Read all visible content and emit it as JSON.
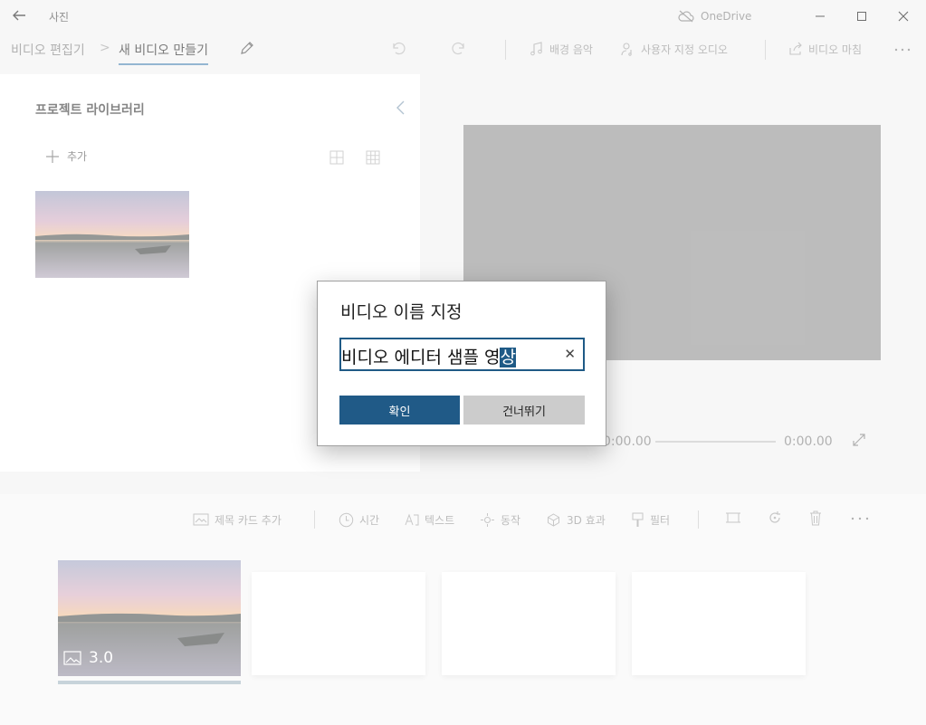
{
  "titlebar": {
    "app_name": "사진",
    "onedrive_label": "OneDrive"
  },
  "commandbar": {
    "breadcrumb_parent": "비디오 편집기",
    "breadcrumb_separator": ">",
    "breadcrumb_current": "새 비디오 만들기",
    "background_music": "배경 음악",
    "custom_audio": "사용자 지정 오디오",
    "finish_video": "비디오 마침"
  },
  "library": {
    "title": "프로젝트 라이브러리",
    "add_label": "추가"
  },
  "preview": {
    "time_start": "0:00.00",
    "time_end": "0:00.00"
  },
  "storyboard": {
    "tools": {
      "title_card": "제목 카드 추가",
      "duration": "시간",
      "text": "텍스트",
      "motion": "동작",
      "effects_3d": "3D 효과",
      "filters": "필터"
    },
    "clip_duration": "3.0"
  },
  "dialog": {
    "title": "비디오 이름 지정",
    "input_value_unselected": "비디오 에디터 샘플 영",
    "input_value_selected": "상",
    "ok_label": "확인",
    "skip_label": "건너뛰기"
  },
  "colors": {
    "accent": "#205a87",
    "preview_fill": "#999999",
    "secondary_button": "#cccccc"
  }
}
